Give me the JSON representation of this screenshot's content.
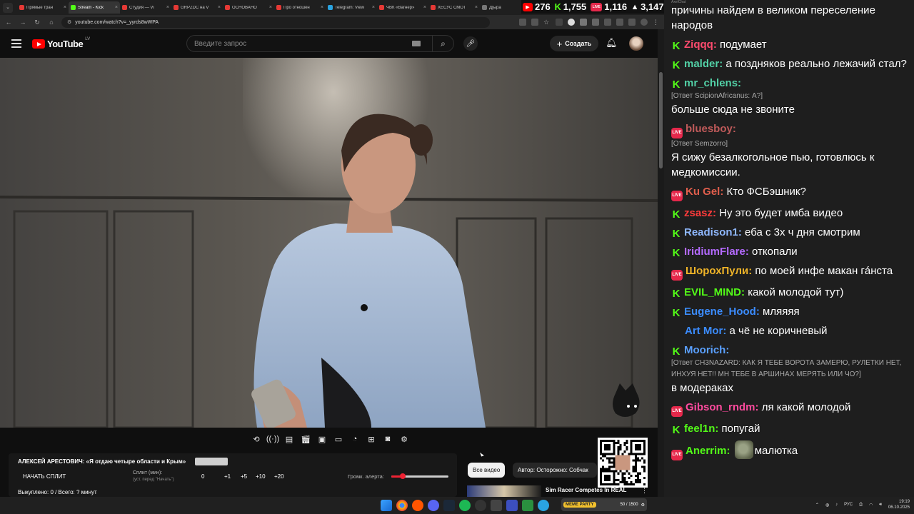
{
  "browser": {
    "tabs": [
      {
        "label": "Прямые тран",
        "color": "#e53935"
      },
      {
        "label": "Stream - Kick",
        "color": "#53fc18"
      },
      {
        "label": "Студия — Vi",
        "color": "#e53935"
      },
      {
        "label": "GRPZDC на V",
        "color": "#e53935"
      },
      {
        "label": "ОСНОВАНО",
        "color": "#e53935"
      },
      {
        "label": "Про отношен",
        "color": "#e53935"
      },
      {
        "label": "Telegram: View",
        "color": "#2aa3e0"
      },
      {
        "label": "ЧВК «Вагнер»",
        "color": "#e53935"
      },
      {
        "label": "ХЕСУС СМОТ",
        "color": "#e53935"
      },
      {
        "label": "Д[ыра",
        "color": "#777777"
      }
    ],
    "url": "youtube.com/watch?v=_yyrds8wWPA"
  },
  "stream_stats": [
    {
      "platform": "youtube",
      "value": "276"
    },
    {
      "platform": "kick",
      "value": "1,755"
    },
    {
      "platform": "vk",
      "value": "1,116"
    },
    {
      "platform": "total",
      "value": "3,147"
    }
  ],
  "youtube": {
    "logo_text": "YouTube",
    "country_code": "LV",
    "search_placeholder": "Введите запрос",
    "create_label": "Создать"
  },
  "video_controls": {
    "icons": [
      "loop-icon",
      "broadcast-icon",
      "subtitles-icon",
      "clapper-icon",
      "picture-in-picture-icon",
      "theater-icon",
      "speedometer-icon",
      "add-box-icon",
      "screenshot-icon",
      "settings-icon"
    ]
  },
  "panel": {
    "title": "АЛЕКСЕЙ АРЕСТОВИЧ: «Я отдаю четыре области и Крым»",
    "split_button": "НАЧАТЬ СПЛИТ",
    "split_label": "Сплит (мин):",
    "split_hint": "(уст. перед \"Начать\")",
    "split_value": "0",
    "increments": [
      "+1",
      "+5",
      "+10",
      "+20"
    ],
    "volume_label": "Громк. алерта:",
    "volume_level": 0.2,
    "bought": "Выкуплено: 0 / Всего: ? минут"
  },
  "chips": {
    "all_videos": "Все видео",
    "author": "Автор: Осторожно: Собчак"
  },
  "next_video": {
    "title": "Sim Racer Competes In REAL"
  },
  "chat": {
    "header_label": "AxelChat",
    "messages": [
      {
        "platform": "none",
        "user": "",
        "color": "#ffffff",
        "reply": "",
        "text": "причины найдем в великом переселение народов"
      },
      {
        "platform": "kick",
        "user": "Ziqqq:",
        "color": "#ff4b6e",
        "reply": "",
        "text": "подумает"
      },
      {
        "platform": "kick",
        "user": "malder:",
        "color": "#52d0a6",
        "reply": "",
        "text": "а поздняков реально лежачий стал?"
      },
      {
        "platform": "kick",
        "user": "mr_chlens:",
        "color": "#52d0a6",
        "reply": "[Ответ ScipionAfricanus: А?]",
        "text": "больше сюда не звоните"
      },
      {
        "platform": "vk",
        "user": "bluesboy:",
        "color": "#c05a5a",
        "reply": "[Ответ Semzorro]",
        "text": "Я сижу безалкогольное пью, готовлюсь к медкомиссии."
      },
      {
        "platform": "vk",
        "user": "Ku Gel:",
        "color": "#e05e4c",
        "reply": "",
        "text": "Кто ФСБэшник?"
      },
      {
        "platform": "kick",
        "user": "zsasz:",
        "color": "#ff3b3b",
        "reply": "",
        "text": "Ну это будет имба видео"
      },
      {
        "platform": "kick",
        "user": "Readison1:",
        "color": "#8fb8ff",
        "reply": "",
        "text": "еба с 3х ч дня смотрим"
      },
      {
        "platform": "kick",
        "user": "IridiumFlare:",
        "color": "#b46aff",
        "reply": "",
        "text": "откопали"
      },
      {
        "platform": "vk",
        "user": "ШорохПули:",
        "color": "#f0b428",
        "reply": "",
        "text": "по моей инфе макан гáнста"
      },
      {
        "platform": "kick",
        "user": "EVIL_MIND:",
        "color": "#53fc18",
        "reply": "",
        "text": "какой молодой тут)"
      },
      {
        "platform": "kick",
        "user": "Eugene_Hood:",
        "color": "#3b8cff",
        "reply": "",
        "text": "мляяяя"
      },
      {
        "platform": "youtube",
        "user": "Art Mor:",
        "color": "#3b8cff",
        "reply": "",
        "text": "а чё не коричневый"
      },
      {
        "platform": "kick",
        "user": "Moorich:",
        "color": "#5aa0ff",
        "reply": "[Ответ CH3NAZARD: КАК Я ТЕБЕ ВОРОТА ЗАМЕРЮ, РУЛЕТКИ НЕТ, ИНХУЯ НЕТ!! МН ТЕБЕ В АРШИНАХ МЕРЯТЬ ИЛИ ЧО?]",
        "text": "в модераках"
      },
      {
        "platform": "vk",
        "user": "Gibson_rndm:",
        "color": "#ff4b9e",
        "reply": "",
        "text": "ля какой молодой"
      },
      {
        "platform": "kick",
        "user": "feel1n:",
        "color": "#53fc18",
        "reply": "",
        "text": "попугай"
      },
      {
        "platform": "vk",
        "user": "Anerrim:",
        "color": "#53fc18",
        "reply": "",
        "text": "малютка",
        "emote": true
      }
    ]
  },
  "taskbar": {
    "meme_label": "MEME PARTY",
    "meme_count": "50 / 1500",
    "lang": "РУС",
    "time": "19:19",
    "date": "06.10.2025"
  }
}
